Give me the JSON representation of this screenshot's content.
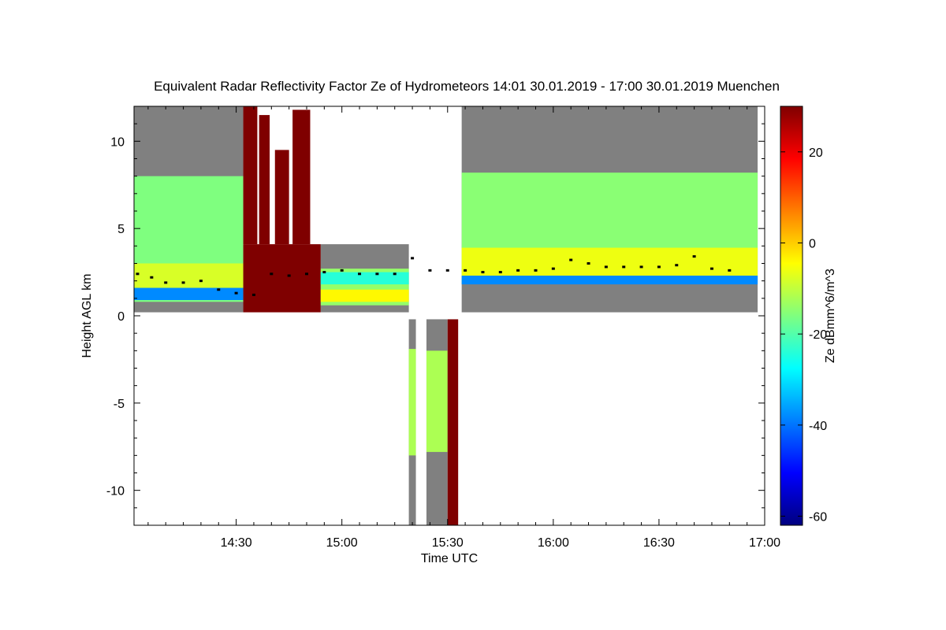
{
  "chart_data": {
    "type": "heatmap",
    "title": "Equivalent Radar Reflectivity Factor Ze of Hydrometeors    14:01 30.01.2019 - 17:00 30.01.2019 Muenchen",
    "xlabel": "Time UTC",
    "ylabel": "Height AGL km",
    "colorbar_label": "Ze dBmm^6/m^3",
    "x_unit": "minutes UTC",
    "xlim": [
      841,
      1020
    ],
    "ylim": [
      -12,
      12
    ],
    "x_ticks": [
      {
        "value": 870,
        "label": "14:30"
      },
      {
        "value": 900,
        "label": "15:00"
      },
      {
        "value": 930,
        "label": "15:30"
      },
      {
        "value": 960,
        "label": "16:00"
      },
      {
        "value": 990,
        "label": "16:30"
      },
      {
        "value": 1020,
        "label": "17:00"
      }
    ],
    "y_ticks": [
      {
        "value": 10,
        "label": "10"
      },
      {
        "value": 5,
        "label": "5"
      },
      {
        "value": 0,
        "label": "0"
      },
      {
        "value": -5,
        "label": "-5"
      },
      {
        "value": -10,
        "label": "-10"
      }
    ],
    "colorbar_range": [
      -62,
      30
    ],
    "colorbar_ticks": [
      {
        "value": 20,
        "label": "20"
      },
      {
        "value": 0,
        "label": "0"
      },
      {
        "value": -20,
        "label": "-20"
      },
      {
        "value": -40,
        "label": "-40"
      },
      {
        "value": -60,
        "label": "-60"
      }
    ],
    "colormap": [
      "#00007f",
      "#0000ff",
      "#007fff",
      "#00ffff",
      "#7fff7f",
      "#ffff00",
      "#ff7f00",
      "#ff0000",
      "#7f0000"
    ],
    "colors": {
      "no_signal": "#808080",
      "saturated": "#7f0000",
      "base_line": "#000000"
    },
    "segments": [
      {
        "name": "segment-1",
        "t": [
          841,
          872
        ],
        "h": [
          0.2,
          12
        ],
        "layers": [
          {
            "h": [
              0.8,
              8.0
            ],
            "ze": -16
          },
          {
            "h": [
              1.3,
              3.0
            ],
            "ze": -8
          },
          {
            "h": [
              0.9,
              1.6
            ],
            "ze": -38
          }
        ]
      },
      {
        "name": "segment-2-saturated",
        "t": [
          872,
          894
        ],
        "h": [
          0.2,
          4.1
        ],
        "ze": 30,
        "spikes": [
          {
            "t": [
              872,
              876
            ],
            "h": [
              4.1,
              12
            ]
          },
          {
            "t": [
              876.5,
              879.5
            ],
            "h": [
              4.1,
              11.5
            ]
          },
          {
            "t": [
              881,
              885
            ],
            "h": [
              4.1,
              9.5
            ]
          },
          {
            "t": [
              886,
              891
            ],
            "h": [
              4.1,
              11.8
            ]
          }
        ]
      },
      {
        "name": "segment-3",
        "t": [
          894,
          919
        ],
        "h": [
          0.2,
          4.1
        ],
        "layers": [
          {
            "h": [
              0.6,
              2.7
            ],
            "ze": -14
          },
          {
            "h": [
              1.8,
              2.5
            ],
            "ze": -24
          },
          {
            "h": [
              0.8,
              1.5
            ],
            "ze": -4
          }
        ]
      },
      {
        "name": "segment-4",
        "t": [
          934,
          1018
        ],
        "h": [
          0.2,
          12
        ],
        "layers": [
          {
            "h": [
              1.9,
              8.2
            ],
            "ze": -15
          },
          {
            "h": [
              2.2,
              3.9
            ],
            "ze": -6
          },
          {
            "h": [
              1.8,
              2.3
            ],
            "ze": -38
          }
        ]
      },
      {
        "name": "segment-lower-1",
        "t": [
          919,
          921
        ],
        "h": [
          -12,
          -0.2
        ],
        "layers": [
          {
            "h": [
              -8.0,
              -1.9
            ],
            "ze": -12
          }
        ]
      },
      {
        "name": "segment-lower-2",
        "t": [
          924,
          930
        ],
        "h": [
          -12,
          -0.2
        ],
        "layers": [
          {
            "h": [
              -7.8,
              -2.0
            ],
            "ze": -12
          }
        ]
      },
      {
        "name": "segment-lower-saturated",
        "t": [
          930,
          933
        ],
        "h": [
          -12,
          -0.2
        ],
        "ze": 30
      }
    ],
    "cloud_base_points": [
      [
        842,
        2.4
      ],
      [
        846,
        2.2
      ],
      [
        850,
        1.9
      ],
      [
        855,
        1.9
      ],
      [
        860,
        2.0
      ],
      [
        865,
        1.5
      ],
      [
        870,
        1.3
      ],
      [
        875,
        1.2
      ],
      [
        880,
        2.4
      ],
      [
        885,
        2.3
      ],
      [
        890,
        2.4
      ],
      [
        895,
        2.5
      ],
      [
        900,
        2.6
      ],
      [
        905,
        2.4
      ],
      [
        910,
        2.4
      ],
      [
        915,
        2.4
      ],
      [
        920,
        3.3
      ],
      [
        925,
        2.6
      ],
      [
        930,
        2.6
      ],
      [
        935,
        2.6
      ],
      [
        940,
        2.5
      ],
      [
        945,
        2.5
      ],
      [
        950,
        2.6
      ],
      [
        955,
        2.6
      ],
      [
        960,
        2.7
      ],
      [
        965,
        3.2
      ],
      [
        970,
        3.0
      ],
      [
        975,
        2.8
      ],
      [
        980,
        2.8
      ],
      [
        985,
        2.8
      ],
      [
        990,
        2.8
      ],
      [
        995,
        2.9
      ],
      [
        1000,
        3.4
      ],
      [
        1005,
        2.7
      ],
      [
        1010,
        2.6
      ]
    ]
  }
}
